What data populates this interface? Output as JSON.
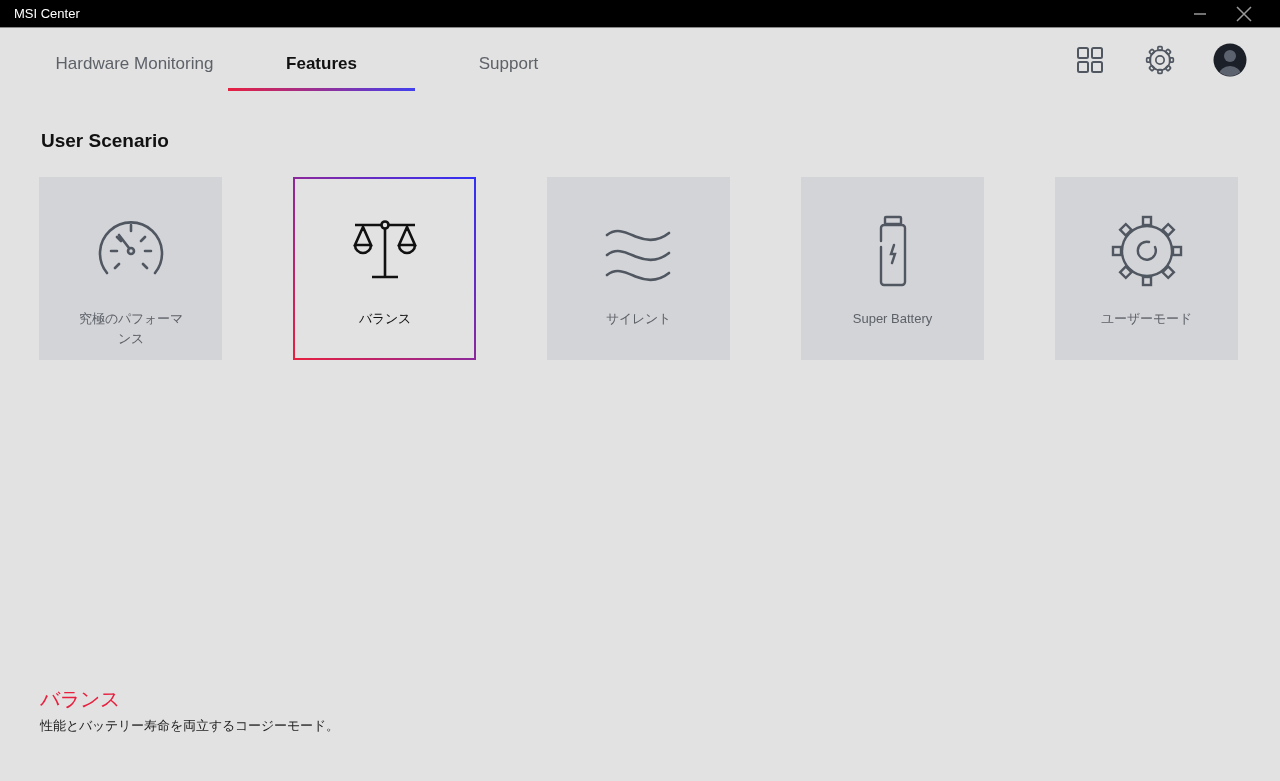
{
  "window": {
    "title": "MSI Center"
  },
  "tabs": [
    {
      "label": "Hardware Monitoring",
      "selected": false
    },
    {
      "label": "Features",
      "selected": true
    },
    {
      "label": "Support",
      "selected": false
    }
  ],
  "section_title": "User Scenario",
  "scenarios": [
    {
      "kind": "gauge",
      "label": "究極のパフォーマンス",
      "selected": false
    },
    {
      "kind": "scale",
      "label": "バランス",
      "selected": true
    },
    {
      "kind": "waves",
      "label": "サイレント",
      "selected": false
    },
    {
      "kind": "battery",
      "label": "Super Battery",
      "selected": false
    },
    {
      "kind": "gear",
      "label": "ユーザーモード",
      "selected": false
    }
  ],
  "description": {
    "title": "バランス",
    "text": "性能とバッテリー寿命を両立するコージーモード。"
  }
}
